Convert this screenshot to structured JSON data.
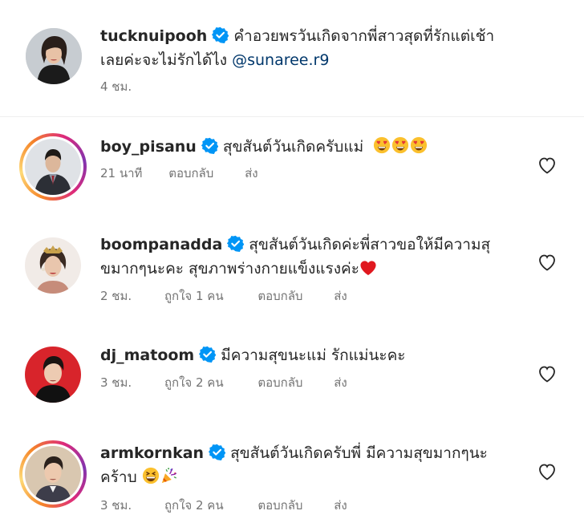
{
  "post_caption": {
    "username": "tucknuipooh",
    "verified": true,
    "text_line1": "คำอวยพรวันเกิดจากพี่สาวสุดที่รักแต่เช้า",
    "text_line2": "เลยค่ะจะไม่รักได้ไง",
    "mention": "@sunaree.r9",
    "time": "4 ชม."
  },
  "comments": [
    {
      "username": "boy_pisanu",
      "verified": true,
      "text_line1": "สุขสันต์วันเกิดครับแม่",
      "emojis": [
        "heart-eyes-emoji",
        "heart-eyes-emoji",
        "heart-eyes-emoji"
      ],
      "time": "21 นาที",
      "likes": "",
      "reply_label": "ตอบกลับ",
      "send_label": "ส่ง"
    },
    {
      "username": "boompanadda",
      "verified": true,
      "text_line1": "สุขสันต์วันเกิดค่ะพี่สาวขอให้มีความสุ",
      "text_line2": "ขมากๆนะคะ สุขภาพร่างกายแข็งแรงค่ะ",
      "emojis": [
        "red-heart-emoji"
      ],
      "time": "2 ชม.",
      "likes": "ถูกใจ 1 คน",
      "reply_label": "ตอบกลับ",
      "send_label": "ส่ง"
    },
    {
      "username": "dj_matoom",
      "verified": true,
      "text_line1": "มีความสุขนะแม่ รักแม่นะคะ",
      "time": "3 ชม.",
      "likes": "ถูกใจ 2 คน",
      "reply_label": "ตอบกลับ",
      "send_label": "ส่ง"
    },
    {
      "username": "armkornkan",
      "verified": true,
      "text_line1": "สุขสันต์วันเกิดครับพี่ มีความสุขมากๆนะ",
      "text_line2": "คร้าบ",
      "emojis": [
        "grinning-squint-emoji",
        "party-popper-emoji"
      ],
      "time": "3 ชม.",
      "likes": "ถูกใจ 2 คน",
      "reply_label": "ตอบกลับ",
      "send_label": "ส่ง"
    }
  ],
  "icons": {
    "verified": "verified-badge-icon",
    "like": "heart-outline-icon"
  },
  "colors": {
    "verified_blue": "#0095f6",
    "mention_blue": "#00376b",
    "meta_gray": "#737373",
    "story_ring": [
      "#f58529",
      "#dd2a7b",
      "#8134af"
    ]
  }
}
